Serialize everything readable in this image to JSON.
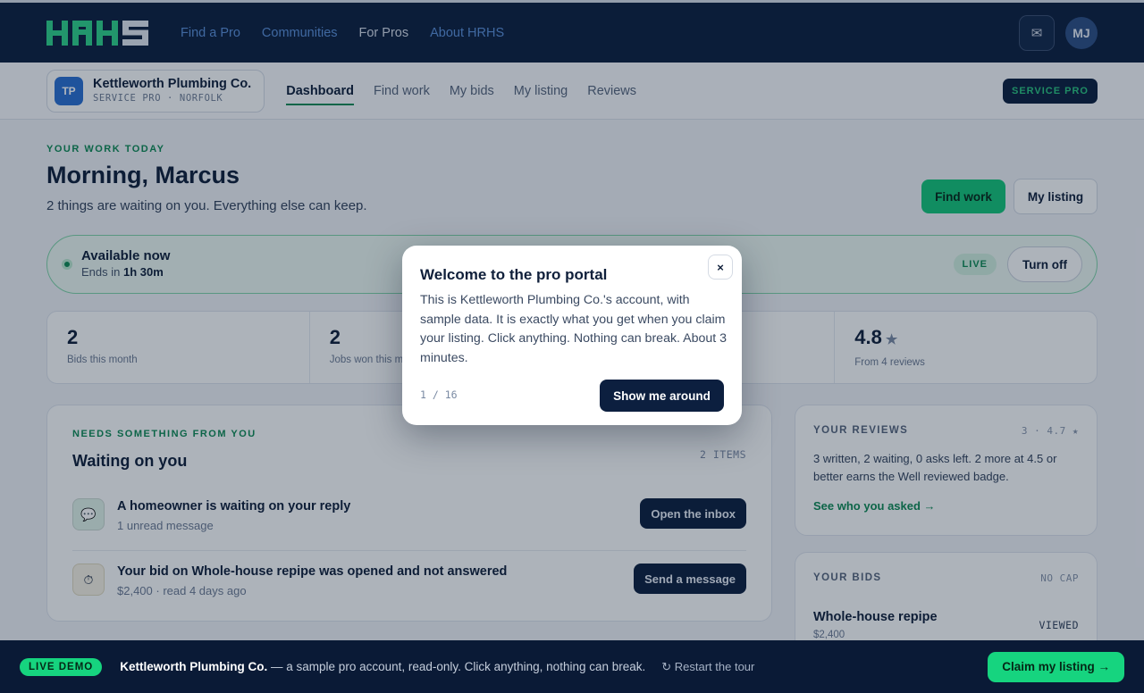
{
  "brand": {
    "logo_text": "HRHS"
  },
  "topnav": {
    "items": [
      {
        "label": "Find a Pro"
      },
      {
        "label": "Communities"
      },
      {
        "label": "For Pros"
      },
      {
        "label": "About HRHS"
      }
    ],
    "mail_icon": "mail-icon",
    "avatar_initials": "MJ"
  },
  "business": {
    "initials": "TP",
    "name": "Kettleworth Plumbing Co.",
    "subtitle": "SERVICE PRO · NORFOLK"
  },
  "subnav": {
    "items": [
      {
        "label": "Dashboard"
      },
      {
        "label": "Find work"
      },
      {
        "label": "My bids"
      },
      {
        "label": "My listing"
      },
      {
        "label": "Reviews"
      }
    ],
    "badge": "SERVICE PRO"
  },
  "header": {
    "eyebrow": "YOUR WORK TODAY",
    "greeting": "Morning, Marcus",
    "subtitle": "2 things are waiting on you. Everything else can keep.",
    "primary_button": "Find work",
    "secondary_button": "My listing"
  },
  "availability": {
    "title": "Available now",
    "ends_prefix": "Ends in",
    "ends_value": "1h 30m",
    "live_label": "LIVE",
    "toggle_label": "Turn off"
  },
  "stats": [
    {
      "value": "2",
      "label": "Bids this month"
    },
    {
      "value": "2",
      "label": "Jobs won this m"
    },
    {
      "value": "",
      "label": ""
    },
    {
      "value": "4.8",
      "label": "From 4 reviews"
    }
  ],
  "waiting": {
    "eyebrow": "NEEDS SOMETHING FROM YOU",
    "title": "Waiting on you",
    "count": "2 ITEMS",
    "items": [
      {
        "title": "A homeowner is waiting on your reply",
        "subtitle": "1 unread message",
        "action": "Open the inbox",
        "icon": "chat-icon"
      },
      {
        "title": "Your bid on Whole-house repipe was opened and not answered",
        "subtitle": "$2,400 · read 4 days ago",
        "action": "Send a message",
        "icon": "timer-icon"
      }
    ]
  },
  "reviews": {
    "title": "YOUR REVIEWS",
    "meta": "3 · 4.7 ★",
    "text": "3 written, 2 waiting, 0 asks left. 2 more at 4.5 or better earns the Well reviewed badge.",
    "link": "See who you asked →"
  },
  "bids": {
    "title": "YOUR BIDS",
    "meta": "NO CAP",
    "item_title": "Whole-house repipe",
    "item_amount": "$2,400",
    "item_status": "VIEWED"
  },
  "modal": {
    "title": "Welcome to the pro portal",
    "body": "This is Kettleworth Plumbing Co.'s account, with sample data. It is exactly what you get when you claim your listing. Click anything. Nothing can break. About 3 minutes.",
    "close": "×",
    "step": "1 / 16",
    "button": "Show me around"
  },
  "demobar": {
    "pill": "LIVE DEMO",
    "business": "Kettleworth Plumbing Co.",
    "text": "— a sample pro account, read-only. Click anything, nothing can break.",
    "restart": "↻ Restart the tour",
    "claim": "Claim my listing →"
  },
  "colors": {
    "navy": "#0c1f3f",
    "green": "#16c47a",
    "accent_green": "#0f8a55",
    "link_blue": "#5b8fd8"
  }
}
